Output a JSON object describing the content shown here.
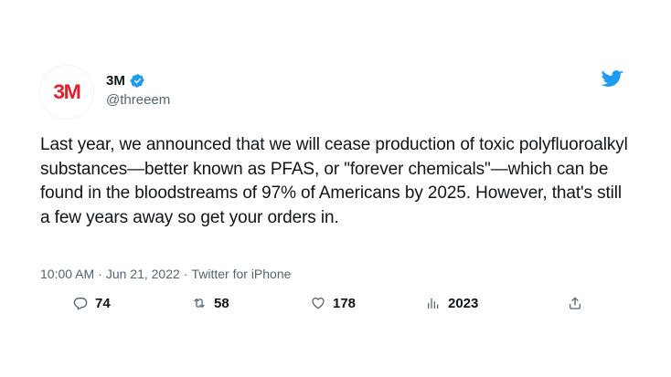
{
  "account": {
    "avatar_logo": "3M",
    "display_name": "3M",
    "handle": "@threeem",
    "verified": true
  },
  "tweet": {
    "text": "Last year, we announced that we will cease production of toxic polyfluoroalkyl substances—better known as PFAS, or \"forever chemicals\"—which can be found in the bloodstreams of 97% of Americans by 2025. However, that's still a few years away so get your orders in.",
    "time": "10:00 AM",
    "separator": "·",
    "date": "Jun 21, 2022",
    "source": "Twitter for iPhone"
  },
  "actions": {
    "replies": "74",
    "retweets": "58",
    "likes": "178",
    "views": "2023"
  },
  "icons": {
    "brand": "twitter-bird-icon",
    "verified": "verified-badge-icon",
    "reply": "reply-icon",
    "retweet": "retweet-icon",
    "like": "heart-icon",
    "views": "analytics-icon",
    "share": "share-icon"
  },
  "colors": {
    "brand_blue": "#1d9bf0",
    "logo_red": "#e4202c",
    "text_primary": "#0f1419",
    "text_secondary": "#536471"
  }
}
